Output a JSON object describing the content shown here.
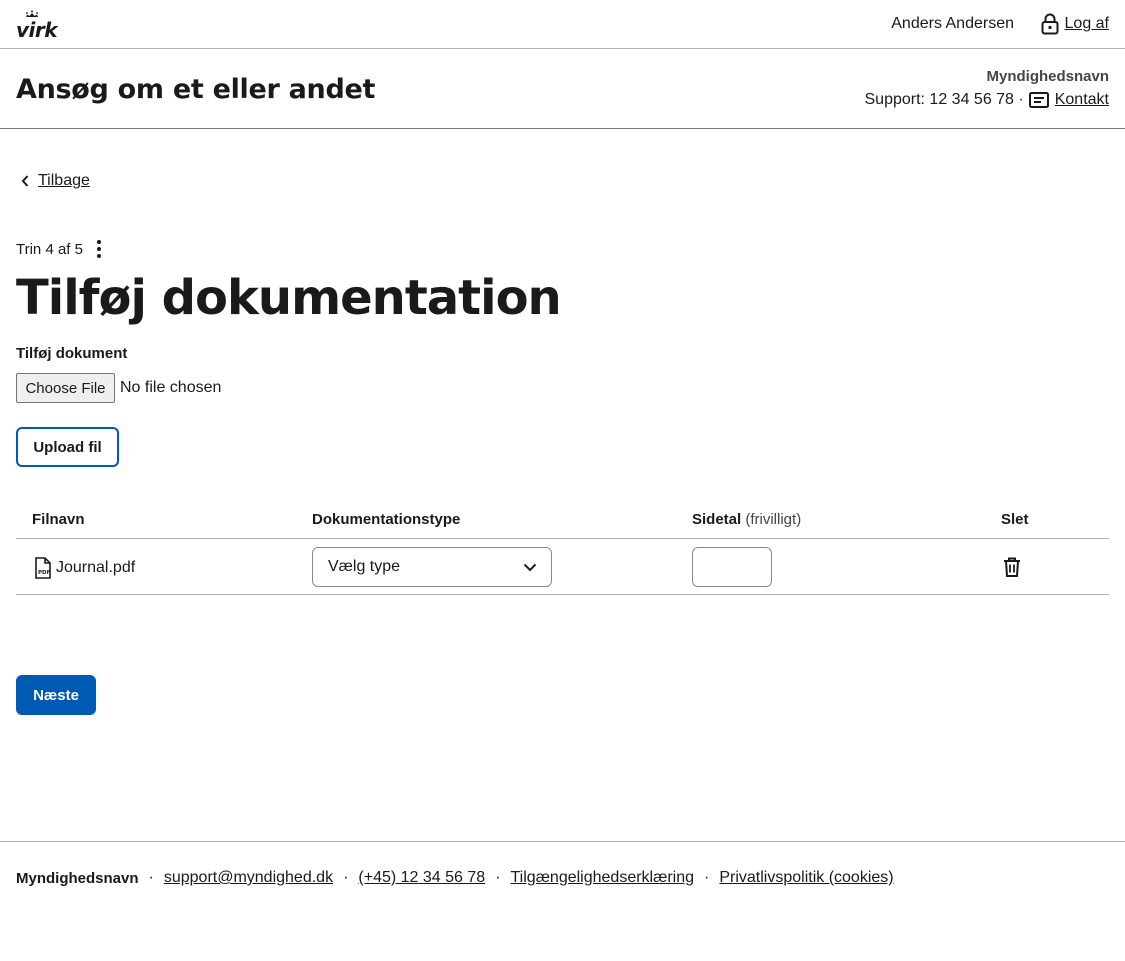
{
  "topbar": {
    "logo_text": "virk",
    "user_name": "Anders Andersen",
    "logout_label": "Log af"
  },
  "header": {
    "title": "Ansøg om et eller andet",
    "authority": "Myndighedsnavn",
    "support": "Support: 12 34 56 78 ·",
    "contact_label": "Kontakt"
  },
  "back_label": "Tilbage",
  "step": "Trin 4 af 5",
  "page_title": "Tilføj dokumentation",
  "upload": {
    "label": "Tilføj dokument",
    "choose_button": "Choose File",
    "status": "No file chosen",
    "upload_button": "Upload fil"
  },
  "table": {
    "headers": {
      "filename": "Filnavn",
      "doctype": "Dokumentationstype",
      "pages": "Sidetal",
      "pages_optional": "(frivilligt)",
      "delete": "Slet"
    },
    "rows": [
      {
        "filename": "Journal.pdf",
        "doctype": "Vælg type",
        "pages": ""
      }
    ]
  },
  "next_button": "Næste",
  "footer": {
    "brand": "Myndighedsnavn",
    "email": "support@myndighed.dk",
    "phone": "(+45) 12 34 56 78",
    "accessibility": "Tilgængelighedserklæring",
    "privacy": "Privatlivspolitik (cookies)",
    "separator": "·"
  },
  "colors": {
    "primary": "#0059b3",
    "text": "#1a1a1a",
    "border": "#b0b0b0"
  }
}
